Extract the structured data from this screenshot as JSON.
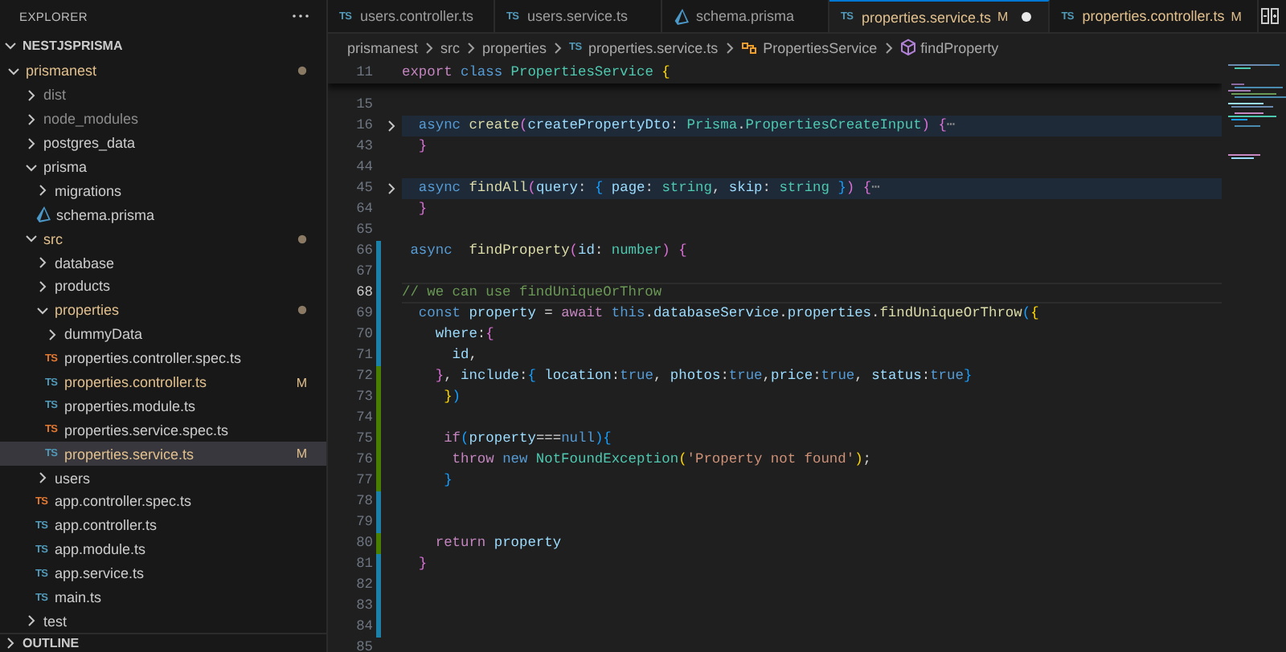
{
  "explorer": {
    "title": "EXPLORER",
    "section": {
      "title": "NESTJSPRISMA",
      "expanded": true,
      "items": [
        {
          "name": "prismanest",
          "kind": "folder",
          "expanded": true,
          "modified": true,
          "ignored": false,
          "selected": false,
          "children": [
            {
              "name": "dist",
              "kind": "folder",
              "expanded": false,
              "modified": false,
              "ignored": true,
              "selected": false
            },
            {
              "name": "node_modules",
              "kind": "folder",
              "expanded": false,
              "modified": false,
              "ignored": true,
              "selected": false
            },
            {
              "name": "postgres_data",
              "kind": "folder",
              "expanded": false,
              "modified": false,
              "ignored": false,
              "selected": false
            },
            {
              "name": "prisma",
              "kind": "folder",
              "expanded": true,
              "modified": false,
              "ignored": false,
              "selected": false,
              "children": [
                {
                  "name": "migrations",
                  "kind": "folder",
                  "expanded": false,
                  "modified": false,
                  "ignored": false,
                  "selected": false
                },
                {
                  "name": "schema.prisma",
                  "kind": "file",
                  "icon": {
                    "kind": "prisma"
                  },
                  "modified": false,
                  "ignored": false,
                  "selected": false
                }
              ]
            },
            {
              "name": "src",
              "kind": "folder",
              "expanded": true,
              "modified": true,
              "ignored": false,
              "selected": false,
              "children": [
                {
                  "name": "database",
                  "kind": "folder",
                  "expanded": false,
                  "modified": false,
                  "ignored": false,
                  "selected": false
                },
                {
                  "name": "products",
                  "kind": "folder",
                  "expanded": false,
                  "modified": false,
                  "ignored": false,
                  "selected": false
                },
                {
                  "name": "properties",
                  "kind": "folder",
                  "expanded": true,
                  "modified": true,
                  "ignored": false,
                  "selected": false,
                  "children": [
                    {
                      "name": "dummyData",
                      "kind": "folder",
                      "expanded": false,
                      "modified": false,
                      "ignored": false,
                      "selected": false
                    },
                    {
                      "name": "properties.controller.spec.ts",
                      "kind": "file",
                      "icon": {
                        "kind": "test",
                        "text": "TS"
                      },
                      "modified": false,
                      "ignored": false,
                      "selected": false
                    },
                    {
                      "name": "properties.controller.ts",
                      "kind": "file",
                      "icon": {
                        "kind": "ts",
                        "text": "TS"
                      },
                      "modified": true,
                      "ignored": false,
                      "badge": "M",
                      "selected": false
                    },
                    {
                      "name": "properties.module.ts",
                      "kind": "file",
                      "icon": {
                        "kind": "ts",
                        "text": "TS"
                      },
                      "modified": false,
                      "ignored": false,
                      "selected": false
                    },
                    {
                      "name": "properties.service.spec.ts",
                      "kind": "file",
                      "icon": {
                        "kind": "test",
                        "text": "TS"
                      },
                      "modified": false,
                      "ignored": false,
                      "selected": false
                    },
                    {
                      "name": "properties.service.ts",
                      "kind": "file",
                      "icon": {
                        "kind": "ts",
                        "text": "TS"
                      },
                      "modified": true,
                      "ignored": false,
                      "badge": "M",
                      "selected": true
                    }
                  ]
                },
                {
                  "name": "users",
                  "kind": "folder",
                  "expanded": false,
                  "modified": false,
                  "ignored": false,
                  "selected": false
                },
                {
                  "name": "app.controller.spec.ts",
                  "kind": "file",
                  "icon": {
                    "kind": "test",
                    "text": "TS"
                  },
                  "modified": false,
                  "ignored": false,
                  "selected": false
                },
                {
                  "name": "app.controller.ts",
                  "kind": "file",
                  "icon": {
                    "kind": "ts",
                    "text": "TS"
                  },
                  "modified": false,
                  "ignored": false,
                  "selected": false
                },
                {
                  "name": "app.module.ts",
                  "kind": "file",
                  "icon": {
                    "kind": "ts",
                    "text": "TS"
                  },
                  "modified": false,
                  "ignored": false,
                  "selected": false
                },
                {
                  "name": "app.service.ts",
                  "kind": "file",
                  "icon": {
                    "kind": "ts",
                    "text": "TS"
                  },
                  "modified": false,
                  "ignored": false,
                  "selected": false
                },
                {
                  "name": "main.ts",
                  "kind": "file",
                  "icon": {
                    "kind": "ts",
                    "text": "TS"
                  },
                  "modified": false,
                  "ignored": false,
                  "selected": false
                }
              ]
            },
            {
              "name": "test",
              "kind": "folder",
              "expanded": false,
              "modified": false,
              "ignored": false,
              "selected": false
            }
          ]
        }
      ]
    },
    "outline": {
      "title": "OUTLINE",
      "expanded": false
    }
  },
  "tabs": [
    {
      "label": "users.controller.ts",
      "icon": {
        "kind": "ts",
        "text": "TS"
      },
      "modified": false,
      "dirty": false,
      "selected": false
    },
    {
      "label": "users.service.ts",
      "icon": {
        "kind": "ts",
        "text": "TS"
      },
      "modified": false,
      "dirty": false,
      "selected": false
    },
    {
      "label": "schema.prisma",
      "icon": {
        "kind": "prisma"
      },
      "modified": false,
      "dirty": false,
      "selected": false
    },
    {
      "label": "properties.service.ts",
      "icon": {
        "kind": "ts",
        "text": "TS"
      },
      "modified": true,
      "badge": "M",
      "dirty": true,
      "selected": true
    },
    {
      "label": "properties.controller.ts",
      "icon": {
        "kind": "ts",
        "text": "TS"
      },
      "modified": true,
      "badge": "M",
      "dirty": false,
      "selected": false
    }
  ],
  "breadcrumbs": [
    {
      "text": "prismanest",
      "icon": {
        "kind": "none"
      }
    },
    {
      "text": "src",
      "icon": {
        "kind": "none"
      }
    },
    {
      "text": "properties",
      "icon": {
        "kind": "none"
      }
    },
    {
      "text": "properties.service.ts",
      "icon": {
        "kind": "ts",
        "text": "TS"
      }
    },
    {
      "text": "PropertiesService",
      "icon": {
        "kind": "class"
      }
    },
    {
      "text": "findProperty",
      "icon": {
        "kind": "method"
      }
    }
  ],
  "editor": {
    "sticky": {
      "number": "11",
      "tokens": [
        {
          "kind": "ctl",
          "text": "export "
        },
        {
          "kind": "kw",
          "text": "class "
        },
        {
          "kind": "type",
          "text": "PropertiesService "
        },
        {
          "kind": "b1",
          "text": "{"
        }
      ]
    },
    "lines": [
      {
        "number": "15",
        "modified": false,
        "added": false,
        "folded": false,
        "current": false
      },
      {
        "number": "16",
        "modified": false,
        "added": false,
        "folded": true,
        "current": false,
        "tokens": [
          {
            "kind": "kw",
            "text": "  async "
          },
          {
            "kind": "fn",
            "text": "create"
          },
          {
            "kind": "b2",
            "text": "("
          },
          {
            "kind": "var",
            "text": "createPropertyDto"
          },
          {
            "kind": "p",
            "text": ": "
          },
          {
            "kind": "type",
            "text": "Prisma"
          },
          {
            "kind": "p",
            "text": "."
          },
          {
            "kind": "type",
            "text": "PropertiesCreateInput"
          },
          {
            "kind": "b2",
            "text": ") {"
          },
          {
            "kind": "fold",
            "text": "⋯"
          }
        ]
      },
      {
        "number": "43",
        "modified": false,
        "added": false,
        "folded": false,
        "current": false,
        "tokens": [
          {
            "kind": "b2",
            "text": "  }"
          }
        ]
      },
      {
        "number": "44",
        "modified": false,
        "added": false,
        "folded": false,
        "current": false
      },
      {
        "number": "45",
        "modified": false,
        "added": false,
        "folded": true,
        "current": false,
        "tokens": [
          {
            "kind": "kw",
            "text": "  async "
          },
          {
            "kind": "fn",
            "text": "findAll"
          },
          {
            "kind": "b2",
            "text": "("
          },
          {
            "kind": "var",
            "text": "query"
          },
          {
            "kind": "p",
            "text": ": "
          },
          {
            "kind": "b3",
            "text": "{ "
          },
          {
            "kind": "var",
            "text": "page"
          },
          {
            "kind": "p",
            "text": ": "
          },
          {
            "kind": "type",
            "text": "string"
          },
          {
            "kind": "p",
            "text": ", "
          },
          {
            "kind": "var",
            "text": "skip"
          },
          {
            "kind": "p",
            "text": ": "
          },
          {
            "kind": "type",
            "text": "string "
          },
          {
            "kind": "b3",
            "text": "}"
          },
          {
            "kind": "b2",
            "text": ") {"
          },
          {
            "kind": "fold",
            "text": "⋯"
          }
        ]
      },
      {
        "number": "64",
        "modified": false,
        "added": false,
        "folded": false,
        "current": false,
        "tokens": [
          {
            "kind": "b2",
            "text": "  }"
          }
        ]
      },
      {
        "number": "65",
        "modified": false,
        "added": false,
        "folded": false,
        "current": false
      },
      {
        "number": "66",
        "modified": true,
        "added": false,
        "folded": false,
        "current": false,
        "tokens": [
          {
            "kind": "kw",
            "text": " async  "
          },
          {
            "kind": "fn",
            "text": "findProperty"
          },
          {
            "kind": "b2",
            "text": "("
          },
          {
            "kind": "var",
            "text": "id"
          },
          {
            "kind": "p",
            "text": ": "
          },
          {
            "kind": "type",
            "text": "number"
          },
          {
            "kind": "b2",
            "text": ") {"
          }
        ]
      },
      {
        "number": "67",
        "modified": true,
        "added": false,
        "folded": false,
        "current": false
      },
      {
        "number": "68",
        "modified": true,
        "added": false,
        "folded": false,
        "current": true,
        "tokens": [
          {
            "kind": "cmt",
            "text": "// we can use findUniqueOrThrow"
          }
        ]
      },
      {
        "number": "69",
        "modified": true,
        "added": false,
        "folded": false,
        "current": false,
        "tokens": [
          {
            "kind": "kw",
            "text": "  const "
          },
          {
            "kind": "var",
            "text": "property"
          },
          {
            "kind": "p",
            "text": " = "
          },
          {
            "kind": "ctl",
            "text": "await "
          },
          {
            "kind": "kw",
            "text": "this"
          },
          {
            "kind": "p",
            "text": "."
          },
          {
            "kind": "var",
            "text": "databaseService"
          },
          {
            "kind": "p",
            "text": "."
          },
          {
            "kind": "var",
            "text": "properties"
          },
          {
            "kind": "p",
            "text": "."
          },
          {
            "kind": "fn",
            "text": "findUniqueOrThrow"
          },
          {
            "kind": "b3",
            "text": "("
          },
          {
            "kind": "b1",
            "text": "{"
          }
        ]
      },
      {
        "number": "70",
        "modified": true,
        "added": false,
        "folded": false,
        "current": false,
        "tokens": [
          {
            "kind": "var",
            "text": "    where"
          },
          {
            "kind": "p",
            "text": ":"
          },
          {
            "kind": "b2",
            "text": "{"
          }
        ]
      },
      {
        "number": "71",
        "modified": true,
        "added": false,
        "folded": false,
        "current": false,
        "tokens": [
          {
            "kind": "var",
            "text": "      id"
          },
          {
            "kind": "p",
            "text": ","
          }
        ]
      },
      {
        "number": "72",
        "modified": false,
        "added": true,
        "folded": false,
        "current": false,
        "tokens": [
          {
            "kind": "b2",
            "text": "    }"
          },
          {
            "kind": "p",
            "text": ", "
          },
          {
            "kind": "var",
            "text": "include"
          },
          {
            "kind": "p",
            "text": ":"
          },
          {
            "kind": "b3",
            "text": "{ "
          },
          {
            "kind": "var",
            "text": "location"
          },
          {
            "kind": "p",
            "text": ":"
          },
          {
            "kind": "kw",
            "text": "true"
          },
          {
            "kind": "p",
            "text": ", "
          },
          {
            "kind": "var",
            "text": "photos"
          },
          {
            "kind": "p",
            "text": ":"
          },
          {
            "kind": "kw",
            "text": "true"
          },
          {
            "kind": "p",
            "text": ","
          },
          {
            "kind": "var",
            "text": "price"
          },
          {
            "kind": "p",
            "text": ":"
          },
          {
            "kind": "kw",
            "text": "true"
          },
          {
            "kind": "p",
            "text": ", "
          },
          {
            "kind": "var",
            "text": "status"
          },
          {
            "kind": "p",
            "text": ":"
          },
          {
            "kind": "kw",
            "text": "true"
          },
          {
            "kind": "b3",
            "text": "}"
          }
        ]
      },
      {
        "number": "73",
        "modified": false,
        "added": true,
        "folded": false,
        "current": false,
        "tokens": [
          {
            "kind": "b1",
            "text": "     }"
          },
          {
            "kind": "b3",
            "text": ")"
          }
        ]
      },
      {
        "number": "74",
        "modified": false,
        "added": true,
        "folded": false,
        "current": false
      },
      {
        "number": "75",
        "modified": false,
        "added": true,
        "folded": false,
        "current": false,
        "tokens": [
          {
            "kind": "ctl",
            "text": "     if"
          },
          {
            "kind": "b3",
            "text": "("
          },
          {
            "kind": "var",
            "text": "property"
          },
          {
            "kind": "p",
            "text": "==="
          },
          {
            "kind": "kw",
            "text": "null"
          },
          {
            "kind": "b3",
            "text": "){"
          }
        ]
      },
      {
        "number": "76",
        "modified": false,
        "added": true,
        "folded": false,
        "current": false,
        "tokens": [
          {
            "kind": "ctl",
            "text": "      throw "
          },
          {
            "kind": "kw",
            "text": "new "
          },
          {
            "kind": "type",
            "text": "NotFoundException"
          },
          {
            "kind": "b1",
            "text": "("
          },
          {
            "kind": "str",
            "text": "'Property not found'"
          },
          {
            "kind": "b1",
            "text": ")"
          },
          {
            "kind": "p",
            "text": ";"
          }
        ]
      },
      {
        "number": "77",
        "modified": false,
        "added": true,
        "folded": false,
        "current": false,
        "tokens": [
          {
            "kind": "b3",
            "text": "     }"
          }
        ]
      },
      {
        "number": "78",
        "modified": true,
        "added": false,
        "folded": false,
        "current": false
      },
      {
        "number": "79",
        "modified": true,
        "added": false,
        "folded": false,
        "current": false
      },
      {
        "number": "80",
        "modified": false,
        "added": true,
        "folded": false,
        "current": false,
        "tokens": [
          {
            "kind": "ctl",
            "text": "    return "
          },
          {
            "kind": "var",
            "text": "property"
          }
        ]
      },
      {
        "number": "81",
        "modified": true,
        "added": false,
        "folded": false,
        "current": false,
        "tokens": [
          {
            "kind": "b2",
            "text": "  }"
          }
        ]
      },
      {
        "number": "82",
        "modified": true,
        "added": false,
        "folded": false,
        "current": false
      },
      {
        "number": "83",
        "modified": true,
        "added": false,
        "folded": false,
        "current": false
      },
      {
        "number": "84",
        "modified": true,
        "added": false,
        "folded": false,
        "current": false
      },
      {
        "number": "85",
        "modified": false,
        "added": false,
        "folded": false,
        "current": false
      }
    ]
  }
}
